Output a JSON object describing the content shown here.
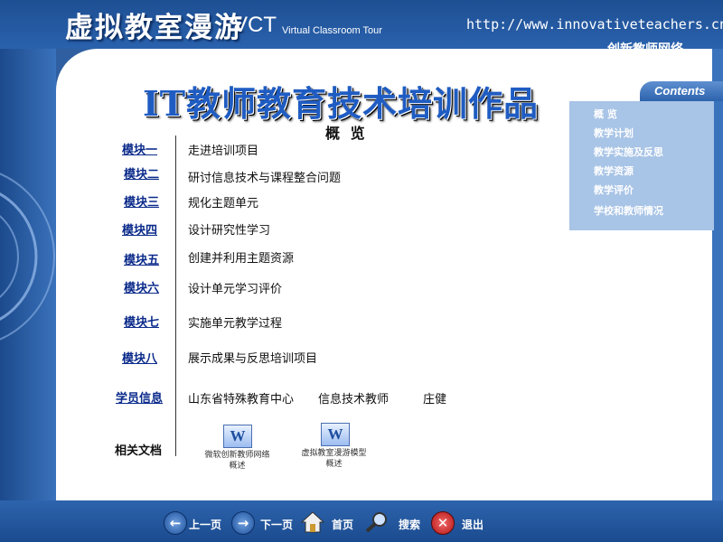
{
  "header": {
    "title_cn": "虚拟教室漫游",
    "title_vct": "VCT",
    "title_en": "Virtual Classroom Tour",
    "url": "http://www.innovativeteachers.cn",
    "network_name": "创新教师网络"
  },
  "main": {
    "title": "IT教师教育技术培训作品",
    "subtitle": "概 览",
    "modules": [
      {
        "link": "模块一",
        "desc": "走进培训项目"
      },
      {
        "link": "模块二",
        "desc": "研讨信息技术与课程整合问题"
      },
      {
        "link": "模块三",
        "desc": "规化主题单元"
      },
      {
        "link": "模块四",
        "desc": "设计研究性学习"
      },
      {
        "link": "模块五",
        "desc": "创建并利用主题资源"
      },
      {
        "link": "模块六",
        "desc": "设计单元学习评价"
      },
      {
        "link": "模块七",
        "desc": "实施单元教学过程"
      },
      {
        "link": "模块八",
        "desc": "展示成果与反思培训项目"
      }
    ],
    "student_info": {
      "label": "学员信息",
      "org": "山东省特殊教育中心",
      "role": "信息技术教师",
      "name": "庄健"
    },
    "docs": {
      "label": "相关文档",
      "items": [
        {
          "line1": "微软创新教师网络",
          "line2": "概述",
          "icon": "word-doc-icon"
        },
        {
          "line1": "虚拟教室漫游模型",
          "line2": "概述",
          "icon": "word-doc-icon"
        }
      ]
    }
  },
  "sidebar": {
    "header": "Contents",
    "items": [
      "概 览",
      "教学计划",
      "教学实施及反思",
      "教学资源",
      "教学评价",
      "学校和教师情况"
    ]
  },
  "nav": {
    "prev": "上一页",
    "next": "下一页",
    "home": "首页",
    "search": "搜索",
    "exit": "退出"
  },
  "colors": {
    "frame_blue": "#2f5fa0",
    "title_blue": "#1f5cc2",
    "link_blue": "#0a2a8a",
    "sidebar_bg": "#a8c4e6",
    "exit_red": "#c81e1e"
  }
}
